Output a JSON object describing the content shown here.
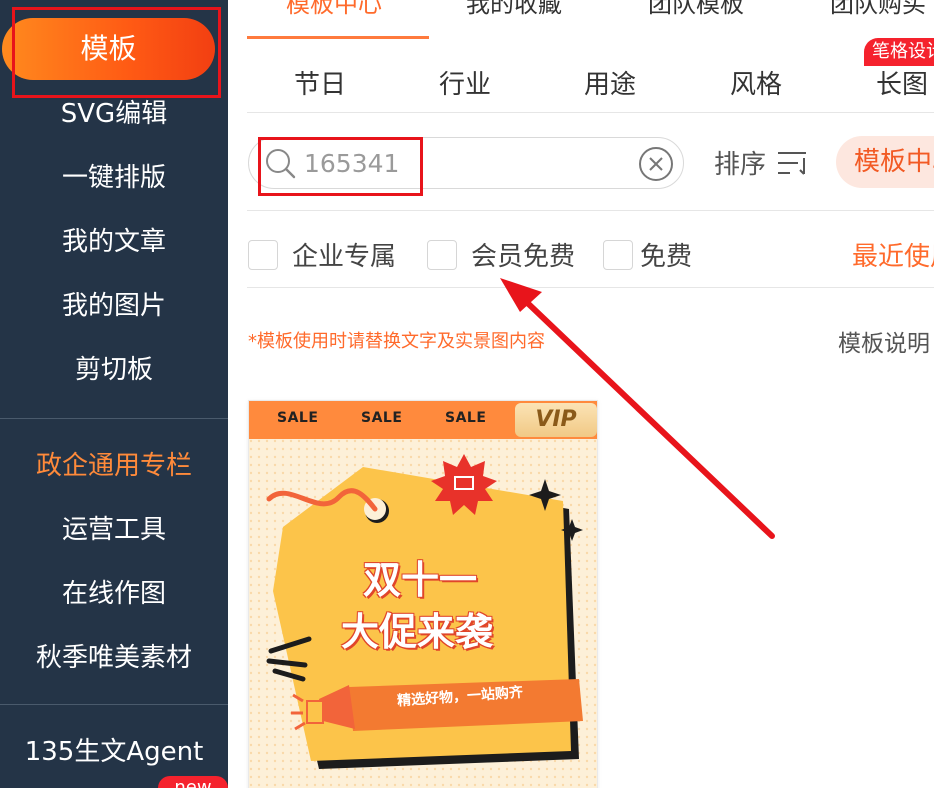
{
  "sidebar": {
    "items": [
      {
        "label": "模板"
      },
      {
        "label": "SVG编辑"
      },
      {
        "label": "一键排版"
      },
      {
        "label": "我的文章"
      },
      {
        "label": "我的图片"
      },
      {
        "label": "剪切板"
      },
      {
        "label": "政企通用专栏"
      },
      {
        "label": "运营工具"
      },
      {
        "label": "在线作图"
      },
      {
        "label": "秋季唯美素材"
      },
      {
        "label": "135生文Agent"
      }
    ],
    "new_badge": "new"
  },
  "top_tabs": [
    "模板中心",
    "我的收藏",
    "团队模板",
    "团队购买"
  ],
  "categories": [
    "节日",
    "行业",
    "用途",
    "风格",
    "长图"
  ],
  "category_badge": "笔格设计",
  "search": {
    "placeholder": "165341",
    "value": ""
  },
  "sort_label": "排序",
  "center_pill": "模板中心",
  "filters": [
    "企业专属",
    "会员免费",
    "免费"
  ],
  "recent_label": "最近使用",
  "notice": "*模板使用时请替换文字及实景图内容",
  "template_desc": "模板说明",
  "card": {
    "sale": [
      "SALE",
      "SALE",
      "SALE"
    ],
    "vip": "VIP",
    "title_line1": "双十一",
    "title_line2": "大促来袭",
    "ribbon": "精选好物，一站购齐"
  },
  "colors": {
    "accent": "#ff6a2b",
    "sidebar_bg": "#243447",
    "highlight": "#e8141b"
  }
}
